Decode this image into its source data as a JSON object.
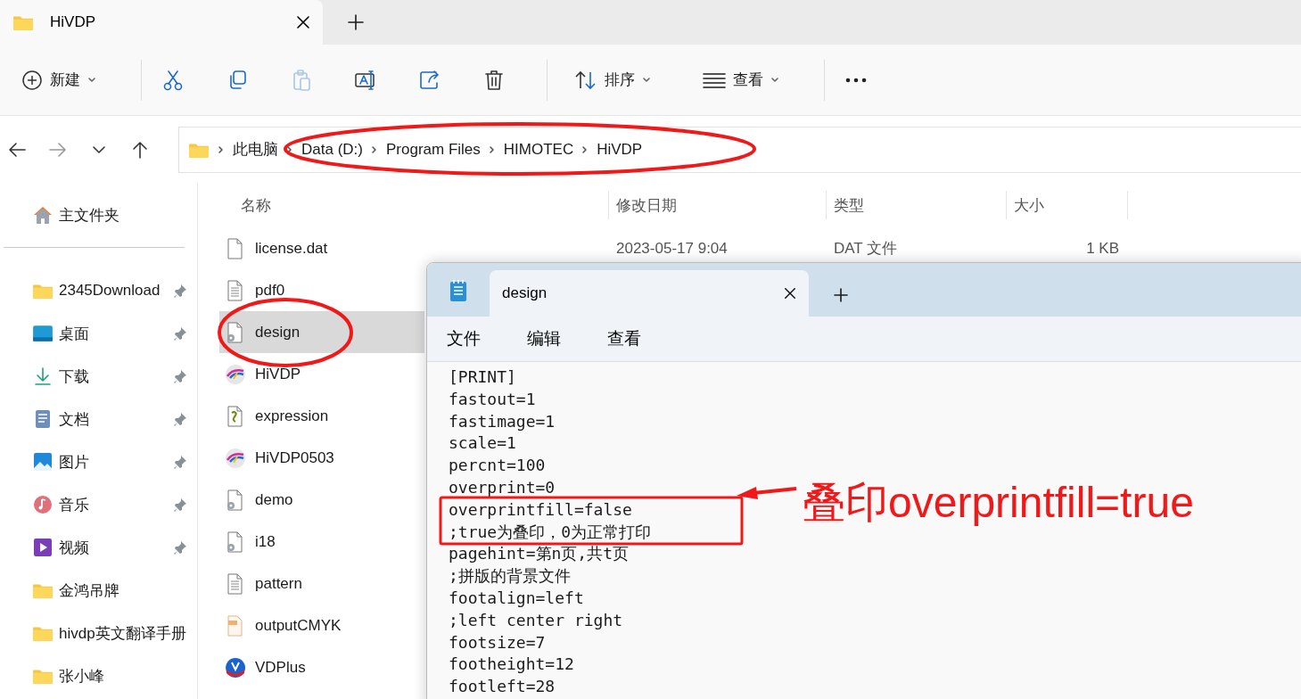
{
  "explorer": {
    "tab": {
      "title": "HiVDP"
    },
    "toolbar": {
      "new_label": "新建",
      "sort_label": "排序",
      "view_label": "查看"
    },
    "breadcrumb": [
      "此电脑",
      "Data (D:)",
      "Program Files",
      "HIMOTEC",
      "HiVDP"
    ],
    "sidebar": {
      "home": "主文件夹",
      "items": [
        {
          "label": "2345Download",
          "pinned": true,
          "kind": "folder"
        },
        {
          "label": "桌面",
          "pinned": true,
          "kind": "desktop"
        },
        {
          "label": "下载",
          "pinned": true,
          "kind": "download"
        },
        {
          "label": "文档",
          "pinned": true,
          "kind": "documents"
        },
        {
          "label": "图片",
          "pinned": true,
          "kind": "pictures"
        },
        {
          "label": "音乐",
          "pinned": true,
          "kind": "music"
        },
        {
          "label": "视频",
          "pinned": true,
          "kind": "video"
        },
        {
          "label": "金鸿吊牌",
          "pinned": false,
          "kind": "folder"
        },
        {
          "label": "hivdp英文翻译手册",
          "pinned": false,
          "kind": "folder"
        },
        {
          "label": "张小峰",
          "pinned": false,
          "kind": "folder"
        }
      ]
    },
    "columns": [
      "名称",
      "修改日期",
      "类型",
      "大小"
    ],
    "files": [
      {
        "name": "license.dat",
        "modified": "2023-05-17 9:04",
        "type": "DAT 文件",
        "size": "1 KB",
        "kind": "blank",
        "selected": false
      },
      {
        "name": "pdf0",
        "kind": "text",
        "selected": false
      },
      {
        "name": "design",
        "kind": "config",
        "selected": true
      },
      {
        "name": "HiVDP",
        "kind": "app",
        "selected": false
      },
      {
        "name": "expression",
        "kind": "script",
        "selected": false
      },
      {
        "name": "HiVDP0503",
        "kind": "app",
        "selected": false
      },
      {
        "name": "demo",
        "kind": "config",
        "selected": false
      },
      {
        "name": "i18",
        "kind": "config",
        "selected": false
      },
      {
        "name": "pattern",
        "kind": "text",
        "selected": false
      },
      {
        "name": "outputCMYK",
        "kind": "image",
        "selected": false
      },
      {
        "name": "VDPlus",
        "kind": "vdplus",
        "selected": false
      }
    ]
  },
  "notepad": {
    "tab": {
      "title": "design"
    },
    "menu": [
      "文件",
      "编辑",
      "查看"
    ],
    "lines": [
      "[PRINT]",
      "fastout=1",
      "fastimage=1",
      "scale=1",
      "percnt=100",
      "overprint=0",
      "overprintfill=false",
      ";true为叠印，0为正常打印",
      "pagehint=第n页,共t页",
      ";拼版的背景文件",
      "footalign=left",
      ";left center right",
      "footsize=7",
      "footheight=12",
      "footleft=28"
    ]
  },
  "annotation": {
    "callout": "叠印overprintfill=true"
  }
}
